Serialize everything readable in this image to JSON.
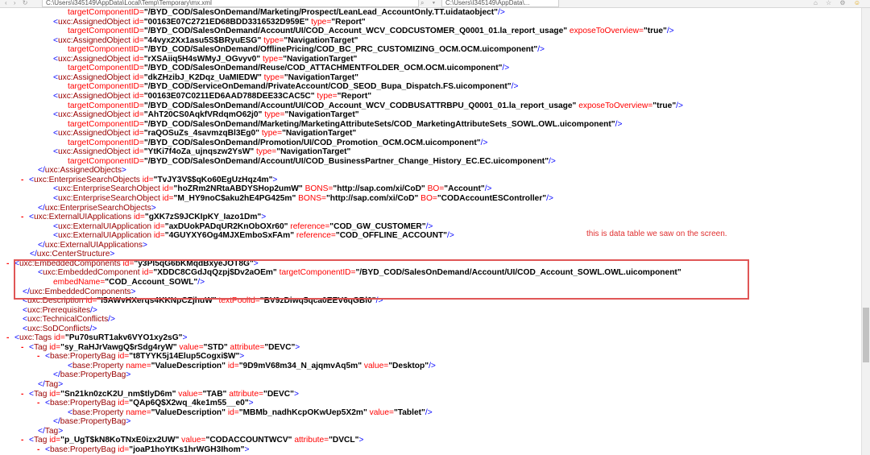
{
  "browser": {
    "address_text": "C:\\Users\\i345149\\AppData\\Local\\Temp\\Temporary\\mx.xml",
    "tab_text": "C:\\Users\\I345149\\AppData\\...",
    "nav_glyphs": "‹ › ↻",
    "addr_icons": "⌕ ▾ ↻",
    "right_icons": "⌂ ☆ ⚙",
    "smile": "☺"
  },
  "annotation": "this is data table we saw on the screen.",
  "xml_lines": [
    {
      "i": 84,
      "p": [
        [
          "an",
          "targetComponentID="
        ],
        [
          "av",
          "\"/BYD_COD/SalesOnDemand/Marketing/Prospect/LeanLead_AccountOnly.TT.uidataobject\""
        ],
        [
          "bl",
          "/>"
        ]
      ]
    },
    {
      "i": 66,
      "p": [
        [
          "bl",
          "<"
        ],
        [
          "tg",
          "uxc:AssignedObject"
        ],
        [
          "an",
          " id="
        ],
        [
          "av",
          "\"00163E07C2721ED68BDD3316532D959E\""
        ],
        [
          "an",
          " type="
        ],
        [
          "av",
          "\"Report\""
        ]
      ]
    },
    {
      "i": 84,
      "p": [
        [
          "an",
          "targetComponentID="
        ],
        [
          "av",
          "\"/BYD_COD/SalesOnDemand/Account/UI/COD_Account_WCV_CODCUSTOMER_Q0001_01.la_report_usage\""
        ],
        [
          "an",
          " exposeToOverview="
        ],
        [
          "av",
          "\"true\""
        ],
        [
          "bl",
          "/>"
        ]
      ]
    },
    {
      "i": 66,
      "p": [
        [
          "bl",
          "<"
        ],
        [
          "tg",
          "uxc:AssignedObject"
        ],
        [
          "an",
          " id="
        ],
        [
          "av",
          "\"44vyx2Xx1asu5S$BRyuESG\""
        ],
        [
          "an",
          " type="
        ],
        [
          "av",
          "\"NavigationTarget\""
        ]
      ]
    },
    {
      "i": 84,
      "p": [
        [
          "an",
          "targetComponentID="
        ],
        [
          "av",
          "\"/BYD_COD/SalesOnDemand/OfflinePricing/COD_BC_PRC_CUSTOMIZING_OCM.OCM.uicomponent\""
        ],
        [
          "bl",
          "/>"
        ]
      ]
    },
    {
      "i": 66,
      "p": [
        [
          "bl",
          "<"
        ],
        [
          "tg",
          "uxc:AssignedObject"
        ],
        [
          "an",
          " id="
        ],
        [
          "av",
          "\"rXSAiiq5H4sWMyJ_OGvyv0\""
        ],
        [
          "an",
          " type="
        ],
        [
          "av",
          "\"NavigationTarget\""
        ]
      ]
    },
    {
      "i": 84,
      "p": [
        [
          "an",
          "targetComponentID="
        ],
        [
          "av",
          "\"/BYD_COD/SalesOnDemand/Reuse/COD_ATTACHMENTFOLDER_OCM.OCM.uicomponent\""
        ],
        [
          "bl",
          "/>"
        ]
      ]
    },
    {
      "i": 66,
      "p": [
        [
          "bl",
          "<"
        ],
        [
          "tg",
          "uxc:AssignedObject"
        ],
        [
          "an",
          " id="
        ],
        [
          "av",
          "\"dkZHzibJ_K2Dqz_UaMIEDW\""
        ],
        [
          "an",
          " type="
        ],
        [
          "av",
          "\"NavigationTarget\""
        ]
      ]
    },
    {
      "i": 84,
      "p": [
        [
          "an",
          "targetComponentID="
        ],
        [
          "av",
          "\"/BYD_COD/ServiceOnDemand/PrivateAccount/COD_SEOD_Bupa_Dispatch.FS.uicomponent\""
        ],
        [
          "bl",
          "/>"
        ]
      ]
    },
    {
      "i": 66,
      "p": [
        [
          "bl",
          "<"
        ],
        [
          "tg",
          "uxc:AssignedObject"
        ],
        [
          "an",
          " id="
        ],
        [
          "av",
          "\"00163E07C0211ED6AAD788DEE33CAC5C\""
        ],
        [
          "an",
          " type="
        ],
        [
          "av",
          "\"Report\""
        ]
      ]
    },
    {
      "i": 84,
      "p": [
        [
          "an",
          "targetComponentID="
        ],
        [
          "av",
          "\"/BYD_COD/SalesOnDemand/Account/UI/COD_Account_WCV_CODBUSATTRBPU_Q0001_01.la_report_usage\""
        ],
        [
          "an",
          " exposeToOverview="
        ],
        [
          "av",
          "\"true\""
        ],
        [
          "bl",
          "/>"
        ]
      ]
    },
    {
      "i": 66,
      "p": [
        [
          "bl",
          "<"
        ],
        [
          "tg",
          "uxc:AssignedObject"
        ],
        [
          "an",
          " id="
        ],
        [
          "av",
          "\"AhT20CS0AqkfVRdqmO62j0\""
        ],
        [
          "an",
          " type="
        ],
        [
          "av",
          "\"NavigationTarget\""
        ]
      ]
    },
    {
      "i": 84,
      "p": [
        [
          "an",
          "targetComponentID="
        ],
        [
          "av",
          "\"/BYD_COD/SalesOnDemand/Marketing/MarketingAttributeSets/COD_MarketingAttributeSets_SOWL.OWL.uicomponent\""
        ],
        [
          "bl",
          "/>"
        ]
      ]
    },
    {
      "i": 66,
      "p": [
        [
          "bl",
          "<"
        ],
        [
          "tg",
          "uxc:AssignedObject"
        ],
        [
          "an",
          " id="
        ],
        [
          "av",
          "\"raQOSuZs_4savmzqBl3Eg0\""
        ],
        [
          "an",
          " type="
        ],
        [
          "av",
          "\"NavigationTarget\""
        ]
      ]
    },
    {
      "i": 84,
      "p": [
        [
          "an",
          "targetComponentID="
        ],
        [
          "av",
          "\"/BYD_COD/SalesOnDemand/Promotion/UI/COD_Promotion_OCM.OCM.uicomponent\""
        ],
        [
          "bl",
          "/>"
        ]
      ]
    },
    {
      "i": 66,
      "p": [
        [
          "bl",
          "<"
        ],
        [
          "tg",
          "uxc:AssignedObject"
        ],
        [
          "an",
          " id="
        ],
        [
          "av",
          "\"YtKi7f4oZa_ujnqszw2YsW\""
        ],
        [
          "an",
          " type="
        ],
        [
          "av",
          "\"NavigationTarget\""
        ]
      ]
    },
    {
      "i": 84,
      "p": [
        [
          "an",
          "targetComponentID="
        ],
        [
          "av",
          "\"/BYD_COD/SalesOnDemand/Account/UI/COD_BusinessPartner_Change_History_EC.EC.uicomponent\""
        ],
        [
          "bl",
          "/>"
        ]
      ]
    },
    {
      "i": 47,
      "p": [
        [
          "bl",
          "</"
        ],
        [
          "tg",
          "uxc:AssignedObjects"
        ],
        [
          "bl",
          ">"
        ]
      ]
    },
    {
      "i": 36,
      "m": "-",
      "p": [
        [
          "bl",
          "<"
        ],
        [
          "tg",
          "uxc:EnterpriseSearchObjects"
        ],
        [
          "an",
          " id="
        ],
        [
          "av",
          "\"TvJY3V$$qKo60EgUzHqz4m\""
        ],
        [
          "bl",
          ">"
        ]
      ]
    },
    {
      "i": 66,
      "p": [
        [
          "bl",
          "<"
        ],
        [
          "tg",
          "uxc:EnterpriseSearchObject"
        ],
        [
          "an",
          " id="
        ],
        [
          "av",
          "\"hoZRm2NRtaABDYSHop2umW\""
        ],
        [
          "an",
          " BONS="
        ],
        [
          "av",
          "\"http://sap.com/xi/CoD\""
        ],
        [
          "an",
          " BO="
        ],
        [
          "av",
          "\"Account\""
        ],
        [
          "bl",
          "/>"
        ]
      ]
    },
    {
      "i": 66,
      "p": [
        [
          "bl",
          "<"
        ],
        [
          "tg",
          "uxc:EnterpriseSearchObject"
        ],
        [
          "an",
          " id="
        ],
        [
          "av",
          "\"M_HY9noC$aku2hE4PG425m\""
        ],
        [
          "an",
          " BONS="
        ],
        [
          "av",
          "\"http://sap.com/xi/CoD\""
        ],
        [
          "an",
          " BO="
        ],
        [
          "av",
          "\"CODAccountESController\""
        ],
        [
          "bl",
          "/>"
        ]
      ]
    },
    {
      "i": 47,
      "p": [
        [
          "bl",
          "</"
        ],
        [
          "tg",
          "uxc:EnterpriseSearchObjects"
        ],
        [
          "bl",
          ">"
        ]
      ]
    },
    {
      "i": 36,
      "m": "-",
      "p": [
        [
          "bl",
          "<"
        ],
        [
          "tg",
          "uxc:ExternalUIApplications"
        ],
        [
          "an",
          " id="
        ],
        [
          "av",
          "\"gXK7zS9JCKIpKY_Iazo1Dm\""
        ],
        [
          "bl",
          ">"
        ]
      ]
    },
    {
      "i": 66,
      "p": [
        [
          "bl",
          "<"
        ],
        [
          "tg",
          "uxc:ExternalUIApplication"
        ],
        [
          "an",
          " id="
        ],
        [
          "av",
          "\"axDUokPADqUR2KnObOXr60\""
        ],
        [
          "an",
          " reference="
        ],
        [
          "av",
          "\"COD_GW_CUSTOMER\""
        ],
        [
          "bl",
          "/>"
        ]
      ]
    },
    {
      "i": 66,
      "p": [
        [
          "bl",
          "<"
        ],
        [
          "tg",
          "uxc:ExternalUIApplication"
        ],
        [
          "an",
          " id="
        ],
        [
          "av",
          "\"4GUYXY6Og4MJXEmboSxFAm\""
        ],
        [
          "an",
          " reference="
        ],
        [
          "av",
          "\"COD_OFFLINE_ACCOUNT\""
        ],
        [
          "bl",
          "/>"
        ]
      ]
    },
    {
      "i": 47,
      "p": [
        [
          "bl",
          "</"
        ],
        [
          "tg",
          "uxc:ExternalUIApplications"
        ],
        [
          "bl",
          ">"
        ]
      ]
    },
    {
      "i": 37,
      "p": [
        [
          "bl",
          "</"
        ],
        [
          "tg",
          "uxc:CenterStructure"
        ],
        [
          "bl",
          ">"
        ]
      ]
    },
    {
      "i": 18,
      "m": "-",
      "p": [
        [
          "bl",
          "<"
        ],
        [
          "tg",
          "uxc:EmbeddedComponents"
        ],
        [
          "an",
          " id="
        ],
        [
          "av",
          "\"y3Pl5qG6bKMqdBxyeJOT8G\""
        ],
        [
          "bl",
          ">"
        ]
      ]
    },
    {
      "i": 47,
      "p": [
        [
          "bl",
          "<"
        ],
        [
          "tg",
          "uxc:EmbeddedComponent"
        ],
        [
          "an",
          " id="
        ],
        [
          "av",
          "\"XDDC8CGdJqQzpj$Dv2aOEm\""
        ],
        [
          "an",
          " targetComponentID="
        ],
        [
          "av",
          "\"/BYD_COD/SalesOnDemand/Account/UI/COD_Account_SOWL.OWL.uicomponent\""
        ]
      ]
    },
    {
      "i": 66,
      "p": [
        [
          "an",
          "embedName="
        ],
        [
          "av",
          "\"COD_Account_SOWL\""
        ],
        [
          "bl",
          "/>"
        ]
      ]
    },
    {
      "i": 28,
      "p": [
        [
          "bl",
          "</"
        ],
        [
          "tg",
          "uxc:EmbeddedComponents"
        ],
        [
          "bl",
          ">"
        ]
      ]
    },
    {
      "i": 28,
      "p": [
        [
          "bl",
          "<"
        ],
        [
          "tg",
          "uxc:Description"
        ],
        [
          "an",
          " id="
        ],
        [
          "av",
          "\"I5AWvHXerqs4KKNpCZjhuW\""
        ],
        [
          "an",
          " textPoolId="
        ],
        [
          "av",
          "\"BV9zDiwq5qca0EEV6qGBl0\""
        ],
        [
          "bl",
          "/>"
        ]
      ]
    },
    {
      "i": 28,
      "p": [
        [
          "bl",
          "<"
        ],
        [
          "tg",
          "uxc:Prerequisites"
        ],
        [
          "bl",
          "/>"
        ]
      ]
    },
    {
      "i": 28,
      "p": [
        [
          "bl",
          "<"
        ],
        [
          "tg",
          "uxc:TechnicalConflicts"
        ],
        [
          "bl",
          "/>"
        ]
      ]
    },
    {
      "i": 28,
      "p": [
        [
          "bl",
          "<"
        ],
        [
          "tg",
          "uxc:SoDConflicts"
        ],
        [
          "bl",
          "/>"
        ]
      ]
    },
    {
      "i": 18,
      "m": "-",
      "p": [
        [
          "bl",
          "<"
        ],
        [
          "tg",
          "uxc:Tags"
        ],
        [
          "an",
          " id="
        ],
        [
          "av",
          "\"Pu70suRT1akv6VYO1xy2sG\""
        ],
        [
          "bl",
          ">"
        ]
      ]
    },
    {
      "i": 36,
      "m": "-",
      "p": [
        [
          "bl",
          "<"
        ],
        [
          "tg",
          "Tag"
        ],
        [
          "an",
          " id="
        ],
        [
          "av",
          "\"sy_RaHJrVawgQ$rSdg4ryW\""
        ],
        [
          "an",
          " value="
        ],
        [
          "av",
          "\"STD\""
        ],
        [
          "an",
          " attribute="
        ],
        [
          "av",
          "\"DEVC\""
        ],
        [
          "bl",
          ">"
        ]
      ]
    },
    {
      "i": 56,
      "m": "-",
      "p": [
        [
          "bl",
          "<"
        ],
        [
          "tg",
          "base:PropertyBag"
        ],
        [
          "an",
          " id="
        ],
        [
          "av",
          "\"t8TYYK5j14Elup5Cogxi$W\""
        ],
        [
          "bl",
          ">"
        ]
      ]
    },
    {
      "i": 84,
      "p": [
        [
          "bl",
          "<"
        ],
        [
          "tg",
          "base:Property"
        ],
        [
          "an",
          " name="
        ],
        [
          "av",
          "\"ValueDescription\""
        ],
        [
          "an",
          " id="
        ],
        [
          "av",
          "\"9D9mV68m34_N_ajqmvAq5m\""
        ],
        [
          "an",
          " value="
        ],
        [
          "av",
          "\"Desktop\""
        ],
        [
          "bl",
          "/>"
        ]
      ]
    },
    {
      "i": 66,
      "p": [
        [
          "bl",
          "</"
        ],
        [
          "tg",
          "base:PropertyBag"
        ],
        [
          "bl",
          ">"
        ]
      ]
    },
    {
      "i": 47,
      "p": [
        [
          "bl",
          "</"
        ],
        [
          "tg",
          "Tag"
        ],
        [
          "bl",
          ">"
        ]
      ]
    },
    {
      "i": 36,
      "m": "-",
      "p": [
        [
          "bl",
          "<"
        ],
        [
          "tg",
          "Tag"
        ],
        [
          "an",
          " id="
        ],
        [
          "av",
          "\"Sn21kn0zcK2U_nm$tlyD6m\""
        ],
        [
          "an",
          " value="
        ],
        [
          "av",
          "\"TAB\""
        ],
        [
          "an",
          " attribute="
        ],
        [
          "av",
          "\"DEVC\""
        ],
        [
          "bl",
          ">"
        ]
      ]
    },
    {
      "i": 56,
      "m": "-",
      "p": [
        [
          "bl",
          "<"
        ],
        [
          "tg",
          "base:PropertyBag"
        ],
        [
          "an",
          " id="
        ],
        [
          "av",
          "\"QAp6Q$X2wq_4ke1m55__e0\""
        ],
        [
          "bl",
          ">"
        ]
      ]
    },
    {
      "i": 84,
      "p": [
        [
          "bl",
          "<"
        ],
        [
          "tg",
          "base:Property"
        ],
        [
          "an",
          " name="
        ],
        [
          "av",
          "\"ValueDescription\""
        ],
        [
          "an",
          " id="
        ],
        [
          "av",
          "\"MBMb_nadhKcpOKwUep5X2m\""
        ],
        [
          "an",
          " value="
        ],
        [
          "av",
          "\"Tablet\""
        ],
        [
          "bl",
          "/>"
        ]
      ]
    },
    {
      "i": 66,
      "p": [
        [
          "bl",
          "</"
        ],
        [
          "tg",
          "base:PropertyBag"
        ],
        [
          "bl",
          ">"
        ]
      ]
    },
    {
      "i": 47,
      "p": [
        [
          "bl",
          "</"
        ],
        [
          "tg",
          "Tag"
        ],
        [
          "bl",
          ">"
        ]
      ]
    },
    {
      "i": 36,
      "m": "-",
      "p": [
        [
          "bl",
          "<"
        ],
        [
          "tg",
          "Tag"
        ],
        [
          "an",
          " id="
        ],
        [
          "av",
          "\"p_UgT$kN8KoTNxE0izx2UW\""
        ],
        [
          "an",
          " value="
        ],
        [
          "av",
          "\"CODACCOUNTWCV\""
        ],
        [
          "an",
          " attribute="
        ],
        [
          "av",
          "\"DVCL\""
        ],
        [
          "bl",
          ">"
        ]
      ]
    },
    {
      "i": 56,
      "m": "-",
      "p": [
        [
          "bl",
          "<"
        ],
        [
          "tg",
          "base:PropertyBag"
        ],
        [
          "an",
          " id="
        ],
        [
          "av",
          "\"joaP1hoYtKs1hrWGH3Ihom\""
        ],
        [
          "bl",
          ">"
        ]
      ]
    }
  ]
}
